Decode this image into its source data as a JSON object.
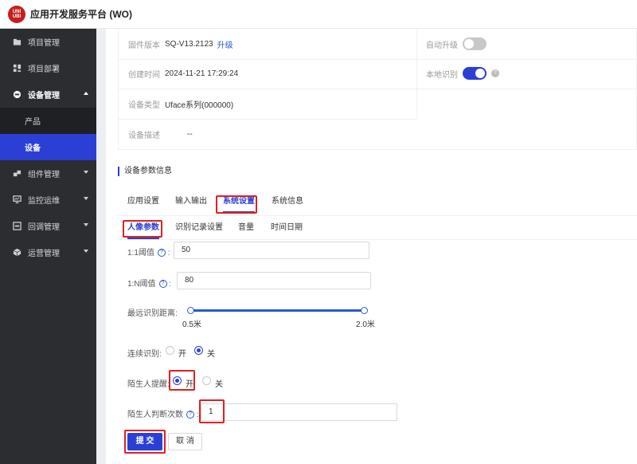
{
  "header": {
    "logo_text": "UNI UBI",
    "title": "应用开发服务平台 (WO)"
  },
  "sidebar": {
    "items": [
      {
        "label": "项目管理",
        "icon": "folder-icon"
      },
      {
        "label": "项目部署",
        "icon": "grid-icon"
      },
      {
        "label": "设备管理",
        "icon": "device-icon",
        "expanded": true,
        "children": [
          {
            "label": "产品",
            "active": false
          },
          {
            "label": "设备",
            "active": true
          }
        ]
      },
      {
        "label": "组件管理",
        "icon": "component-icon"
      },
      {
        "label": "监控运维",
        "icon": "monitor-icon"
      },
      {
        "label": "回调管理",
        "icon": "callback-icon"
      },
      {
        "label": "运营管理",
        "icon": "cube-icon"
      }
    ]
  },
  "device_info": {
    "firmware_label": "固件版本",
    "firmware_value": "SQ-V13.2123",
    "upgrade_link": "升级",
    "auto_upgrade_label": "自动升级",
    "auto_upgrade_on": false,
    "created_label": "创建时间",
    "created_value": "2024-11-21 17:29:24",
    "local_recog_label": "本地识别",
    "local_recog_on": true,
    "type_label": "设备类型",
    "type_value": "Uface系列(000000)",
    "desc_label": "设备描述",
    "desc_value": "--"
  },
  "params": {
    "section_title": "设备参数信息",
    "tabs": [
      "应用设置",
      "输入输出",
      "系统设置",
      "系统信息"
    ],
    "active_tab": "系统设置",
    "subtabs": [
      "人像参数",
      "识别记录设置",
      "音量",
      "时间日期"
    ],
    "active_subtab": "人像参数",
    "threshold_1_1_label": "1:1阈值",
    "threshold_1_1_value": "50",
    "threshold_1_n_label": "1:N阈值",
    "threshold_1_n_value": "80",
    "distance_label": "最远识别距离:",
    "distance_min": "0.5米",
    "distance_max": "2.0米",
    "continuous_label": "连续识别:",
    "stranger_alert_label": "陌生人提醒:",
    "option_on": "开",
    "option_off": "关",
    "continuous_value": "关",
    "stranger_alert_value": "开",
    "stranger_count_label": "陌生人判断次数",
    "stranger_count_value": "1",
    "colon": ":",
    "help_glyph": "?"
  },
  "actions": {
    "submit": "提 交",
    "cancel": "取 消"
  },
  "colors": {
    "accent": "#2b3fd4",
    "sidebar_bg": "#2b2d31",
    "highlight_box": "#e02020"
  }
}
